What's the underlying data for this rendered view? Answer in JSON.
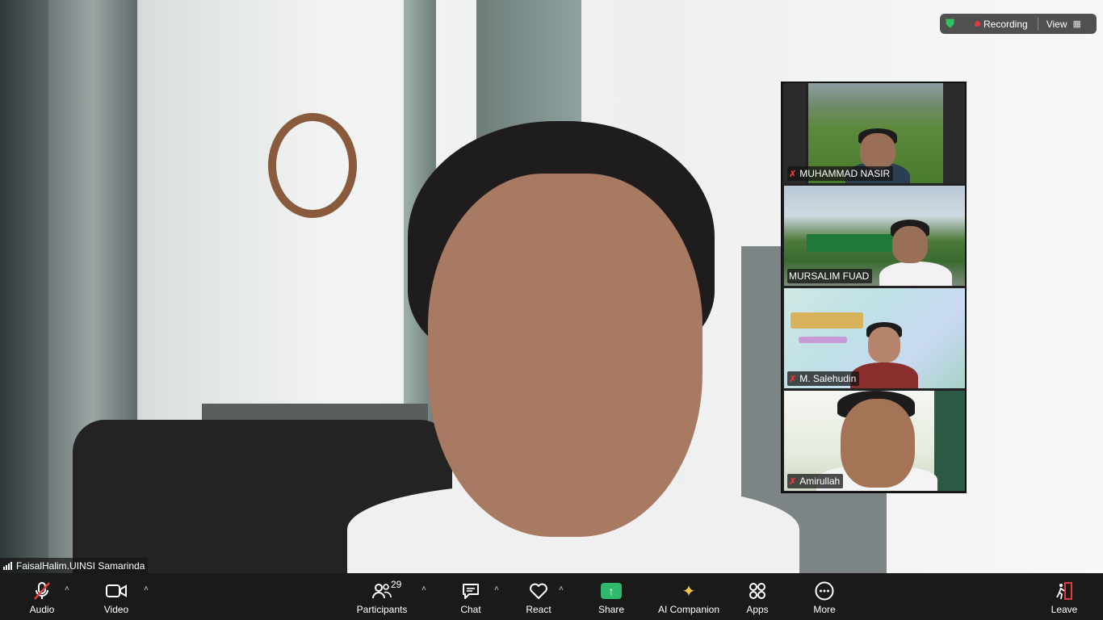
{
  "topbar": {
    "shield_icon": "shield-check-icon",
    "recording_label": "Recording",
    "view_label": "View",
    "accent_green": "#2ec25d",
    "recording_red": "#e63c3c"
  },
  "self_view": {
    "name": "FaisalHalim.UINSI Samarinda"
  },
  "gallery": {
    "tiles": [
      {
        "name": "MUHAMMAD NASIR",
        "muted": true
      },
      {
        "name": "MURSALIM FUAD",
        "muted": false
      },
      {
        "name": "M. Salehudin",
        "muted": true
      },
      {
        "name": "Amirullah",
        "muted": true
      }
    ]
  },
  "toolbar": {
    "audio_label": "Audio",
    "video_label": "Video",
    "participants_label": "Participants",
    "participants_count": "29",
    "chat_label": "Chat",
    "react_label": "React",
    "share_label": "Share",
    "ai_companion_label": "AI Companion",
    "apps_label": "Apps",
    "more_label": "More",
    "leave_label": "Leave",
    "share_color": "#2fb96a",
    "mute_color": "#e23b3b"
  }
}
